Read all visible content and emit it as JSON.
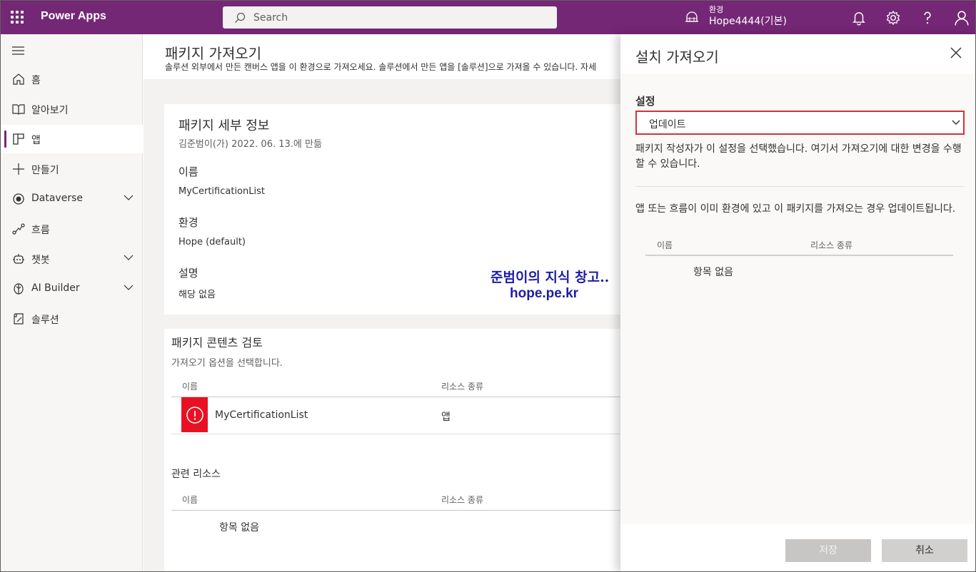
{
  "topbar": {
    "app_title": "Power Apps",
    "search_placeholder": "Search",
    "env_label": "환경",
    "env_name": "Hope4444(기본)"
  },
  "nav": {
    "items": [
      {
        "label": "홈",
        "icon": "home-icon"
      },
      {
        "label": "알아보기",
        "icon": "book-icon"
      },
      {
        "label": "앱",
        "icon": "apps-icon"
      },
      {
        "label": "만들기",
        "icon": "plus-icon"
      },
      {
        "label": "Dataverse",
        "icon": "dataverse-icon"
      },
      {
        "label": "흐름",
        "icon": "flow-icon"
      },
      {
        "label": "챗봇",
        "icon": "bot-icon"
      },
      {
        "label": "AI Builder",
        "icon": "brain-icon"
      },
      {
        "label": "솔루션",
        "icon": "solution-icon"
      }
    ],
    "selected": "앱"
  },
  "main": {
    "title": "패키지 가져오기",
    "description": "솔루션 외부에서 만든 캔버스 앱을 이 환경으로 가져오세요. 솔루션에서 만든 앱을 [솔루션]으로 가져올 수 있습니다. 자세",
    "details": {
      "heading": "패키지 세부 정보",
      "created": "김준범이(가) 2022. 06. 13.에 만듦",
      "name_label": "이름",
      "name_value": "MyCertificationList",
      "env_label": "환경",
      "env_value": "Hope (default)",
      "desc_label": "설명",
      "desc_value": "해당 없음"
    },
    "watermark": {
      "line1": "준범이의 지식 창고..",
      "line2": "hope.pe.kr"
    },
    "review": {
      "heading": "패키지 콘텐츠 검토",
      "sub": "가져오기 옵션을 선택합니다.",
      "col_name": "이름",
      "col_type": "리소스 종류",
      "rows": [
        {
          "name": "MyCertificationList",
          "type": "앱"
        }
      ],
      "related_heading": "관련 리소스",
      "related_col_name": "이름",
      "related_col_type": "리소스 종류",
      "related_empty": "항목 없음"
    }
  },
  "panel": {
    "title": "설치 가져오기",
    "setting_label": "설정",
    "setting_value": "업데이트",
    "note1": "패키지 작성자가 이 설정을 선택했습니다. 여기서 가져오기에 대한 변경을 수행할 수 있습니다.",
    "note2": "앱 또는 흐름이 이미 환경에 있고 이 패키지를 가져오는 경우 업데이트됩니다.",
    "col_name": "이름",
    "col_type": "리소스 종류",
    "empty": "항목 없음",
    "save_label": "저장",
    "cancel_label": "취소"
  },
  "colors": {
    "brand": "#742774",
    "error": "#e81123",
    "focus": "#d13438"
  }
}
